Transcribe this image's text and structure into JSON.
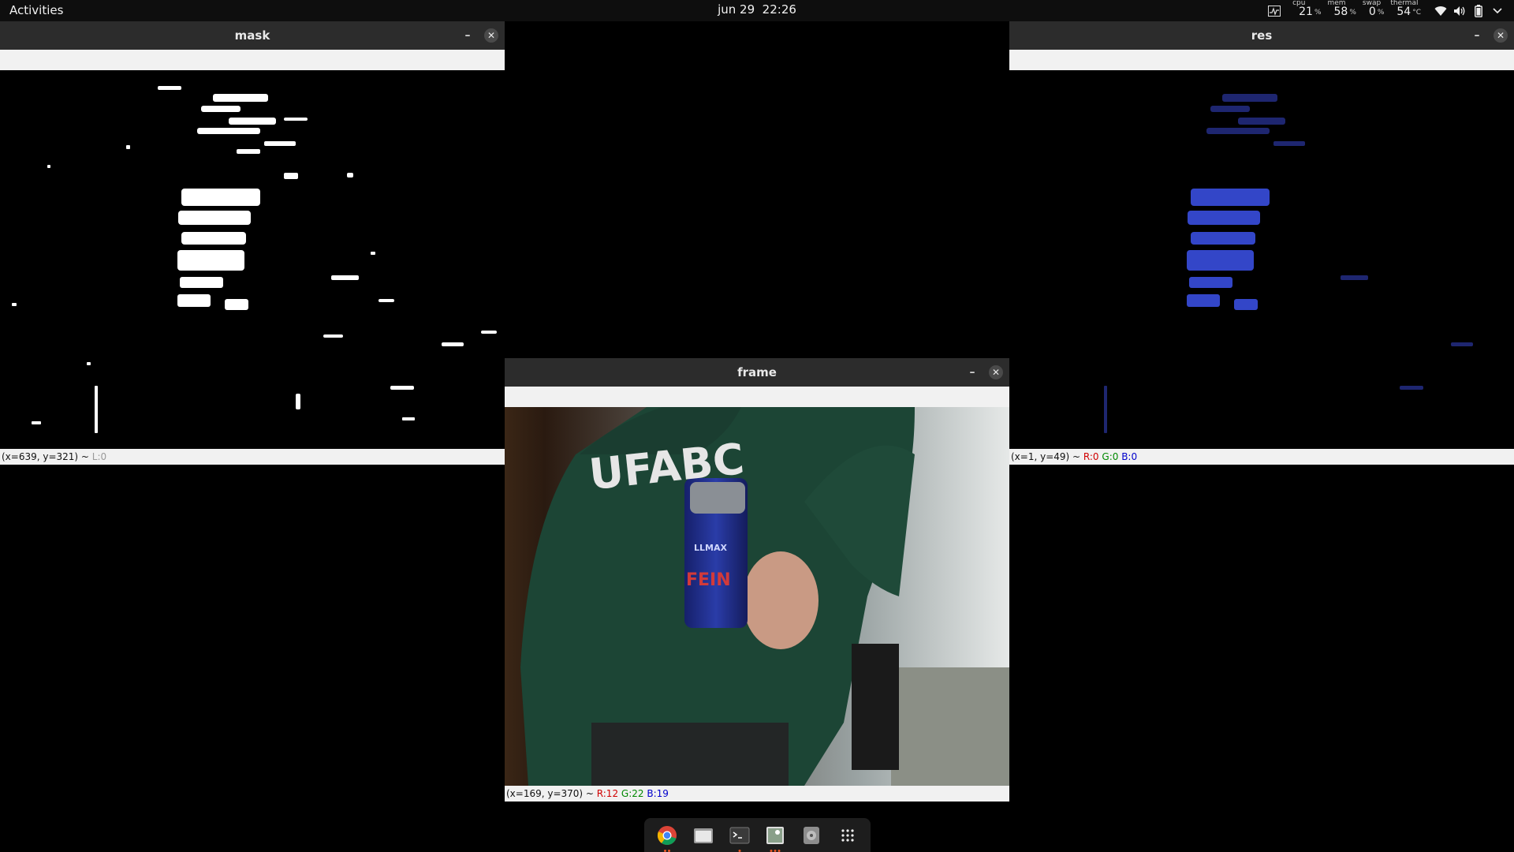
{
  "topbar": {
    "activities_label": "Activities",
    "date": "jun 29",
    "time": "22:26",
    "stats": [
      {
        "caption": "cpu",
        "value": "21",
        "unit": "%"
      },
      {
        "caption": "mem",
        "value": "58",
        "unit": "%"
      },
      {
        "caption": "swap",
        "value": "0",
        "unit": "%"
      },
      {
        "caption": "thermal",
        "value": "54",
        "unit": "°C"
      }
    ],
    "icons": [
      "system-monitor-icon",
      "wifi-icon",
      "volume-icon",
      "battery-icon",
      "chevron-down-icon"
    ]
  },
  "windows": {
    "mask": {
      "title": "mask",
      "status": {
        "coords": "(x=639, y=321) ~ ",
        "l": "L:0"
      }
    },
    "res": {
      "title": "res",
      "status": {
        "coords": "(x=1, y=49) ~ ",
        "r": "R:0",
        "g": "G:0",
        "b": "B:0"
      }
    },
    "frame": {
      "title": "frame",
      "status": {
        "coords": "(x=169, y=370) ~ ",
        "r": "R:12",
        "g": "G:22",
        "b": "B:19"
      },
      "image_text": {
        "shirt": "UFABC",
        "bottle_brand": "LLMAX",
        "bottle_label": "FEIN"
      }
    }
  },
  "dock": {
    "items": [
      {
        "name": "chrome-icon",
        "running": 2
      },
      {
        "name": "files-icon",
        "running": 0
      },
      {
        "name": "terminal-icon",
        "running": 1
      },
      {
        "name": "image-viewer-icon",
        "running": 3
      },
      {
        "name": "disk-icon",
        "running": 0
      },
      {
        "name": "app-grid-icon",
        "running": 0
      }
    ]
  },
  "colors": {
    "topbar_bg": "#0e0e0e",
    "titlebar_bg": "#2c2c2c",
    "dock_bg": "#1d1d1d",
    "running_dot": "#e95420"
  }
}
